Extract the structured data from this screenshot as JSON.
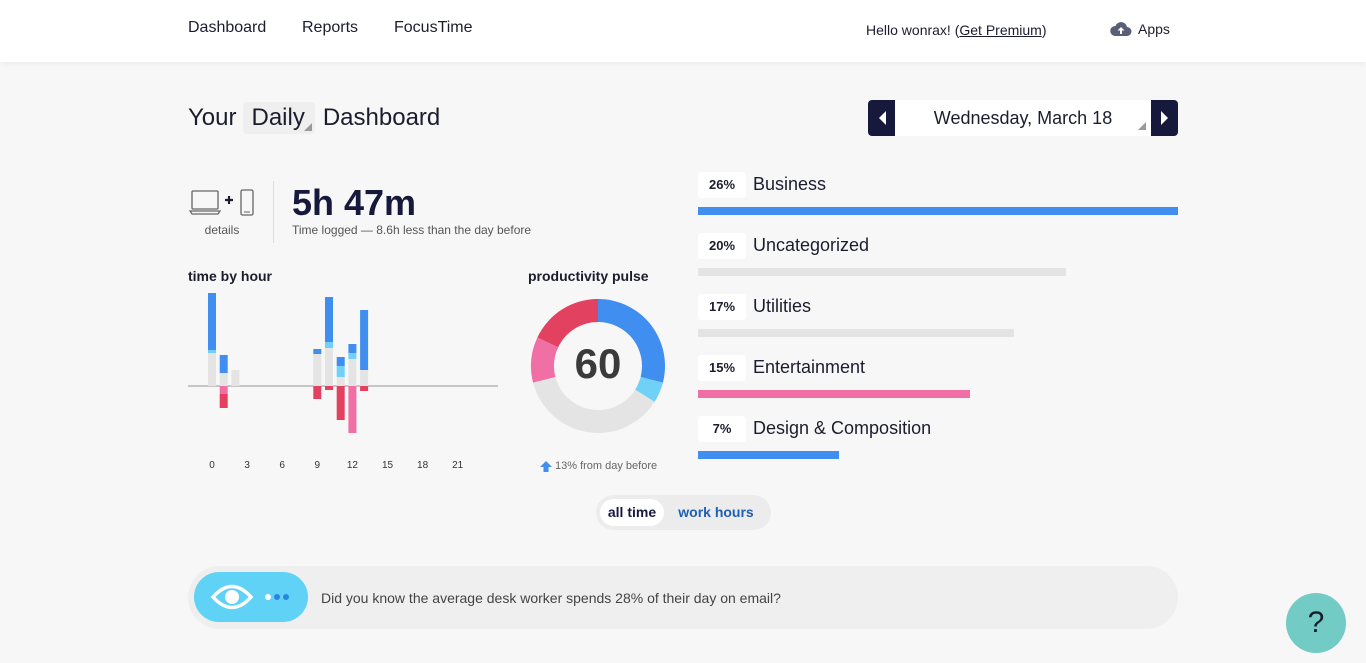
{
  "nav": {
    "links": [
      "Dashboard",
      "Reports",
      "FocusTime"
    ],
    "greeting_prefix": "Hello wonrax! (",
    "premium_link": "Get Premium",
    "greeting_suffix": ")",
    "apps_label": "Apps",
    "apps_icon": "cloud-upload-icon"
  },
  "header": {
    "prefix": "Your",
    "period": "Daily",
    "suffix": "Dashboard",
    "date": "Wednesday, March 18"
  },
  "summary": {
    "devices_label": "details",
    "total_time": "5h 47m",
    "subtitle": "Time logged — 8.6h less than the day before"
  },
  "time_by_hour": {
    "title": "time by hour",
    "tick_labels": [
      "0",
      "3",
      "6",
      "9",
      "12",
      "15",
      "18",
      "21"
    ]
  },
  "pulse": {
    "title": "productivity pulse",
    "value": "60",
    "delta": "13% from day before"
  },
  "categories": [
    {
      "pct": "26%",
      "name": "Business",
      "fraction": 1.0,
      "color": "#3f8ef0"
    },
    {
      "pct": "20%",
      "name": "Uncategorized",
      "fraction": 0.767,
      "color": "#e4e4e4"
    },
    {
      "pct": "17%",
      "name": "Utilities",
      "fraction": 0.658,
      "color": "#e4e4e4"
    },
    {
      "pct": "15%",
      "name": "Entertainment",
      "fraction": 0.567,
      "color": "#f06fa4"
    },
    {
      "pct": "7%",
      "name": "Design & Composition",
      "fraction": 0.294,
      "color": "#3f8ef0"
    }
  ],
  "toggle": {
    "active": "all time",
    "inactive": "work hours"
  },
  "tip": {
    "text": "Did you know the average desk worker spends 28% of their day on email?"
  },
  "help": {
    "label": "?"
  },
  "chart_data": {
    "type": "bar",
    "title": "time by hour",
    "xlabel": "",
    "ylabel": "",
    "x_ticks": [
      0,
      3,
      6,
      9,
      12,
      15,
      18,
      21
    ],
    "colors": {
      "very_productive": "#3f8ef0",
      "productive": "#6fd1f8",
      "neutral": "#e4e4e4",
      "distracting": "#f06fa4",
      "very_distracting": "#e2415f"
    },
    "hours": [
      {
        "hour": 0,
        "very_productive": 57,
        "productive": 3,
        "neutral": 33,
        "distracting": 0,
        "very_distracting": 0
      },
      {
        "hour": 1,
        "very_productive": 18,
        "productive": 0,
        "neutral": 13,
        "distracting": 8,
        "very_distracting": 14
      },
      {
        "hour": 2,
        "very_productive": 0,
        "productive": 0,
        "neutral": 16,
        "distracting": 0,
        "very_distracting": 0
      },
      {
        "hour": 9,
        "very_productive": 5,
        "productive": 0,
        "neutral": 32,
        "distracting": 0,
        "very_distracting": 13
      },
      {
        "hour": 10,
        "very_productive": 45,
        "productive": 6,
        "neutral": 38,
        "distracting": 0,
        "very_distracting": 4
      },
      {
        "hour": 11,
        "very_productive": 9,
        "productive": 11,
        "neutral": 9,
        "distracting": 0,
        "very_distracting": 34
      },
      {
        "hour": 12,
        "very_productive": 9,
        "productive": 6,
        "neutral": 27,
        "distracting": 47,
        "very_distracting": 0
      },
      {
        "hour": 13,
        "very_productive": 60,
        "productive": 0,
        "neutral": 16,
        "distracting": 0,
        "very_distracting": 5
      }
    ],
    "pulse": {
      "value": 60,
      "segments": [
        {
          "name": "very productive",
          "fraction": 0.29,
          "color": "#3f8ef0"
        },
        {
          "name": "productive",
          "fraction": 0.05,
          "color": "#6fd1f8"
        },
        {
          "name": "neutral",
          "fraction": 0.37,
          "color": "#e4e4e4"
        },
        {
          "name": "distracting",
          "fraction": 0.11,
          "color": "#f06fa4"
        },
        {
          "name": "very distracting",
          "fraction": 0.18,
          "color": "#e2415f"
        }
      ]
    }
  }
}
